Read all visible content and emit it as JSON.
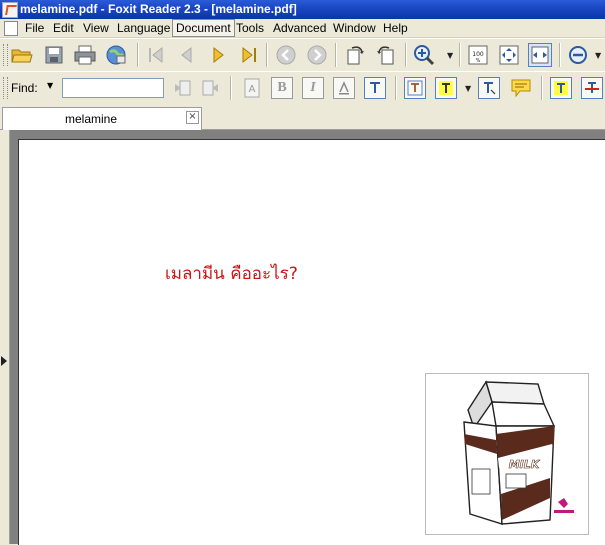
{
  "window": {
    "title": "melamine.pdf - Foxit Reader 2.3 - [melamine.pdf]"
  },
  "menu": [
    "File",
    "Edit",
    "View",
    "Language",
    "Document",
    "Tools",
    "Advanced",
    "Window",
    "Help"
  ],
  "find": {
    "label": "Find:",
    "value": ""
  },
  "tab": {
    "label": "melamine",
    "close": "×"
  },
  "document": {
    "heading": "เมลามีน คืออะไร?",
    "heading_color": "#cc1414"
  },
  "image": {
    "carton_label": "MILK"
  }
}
